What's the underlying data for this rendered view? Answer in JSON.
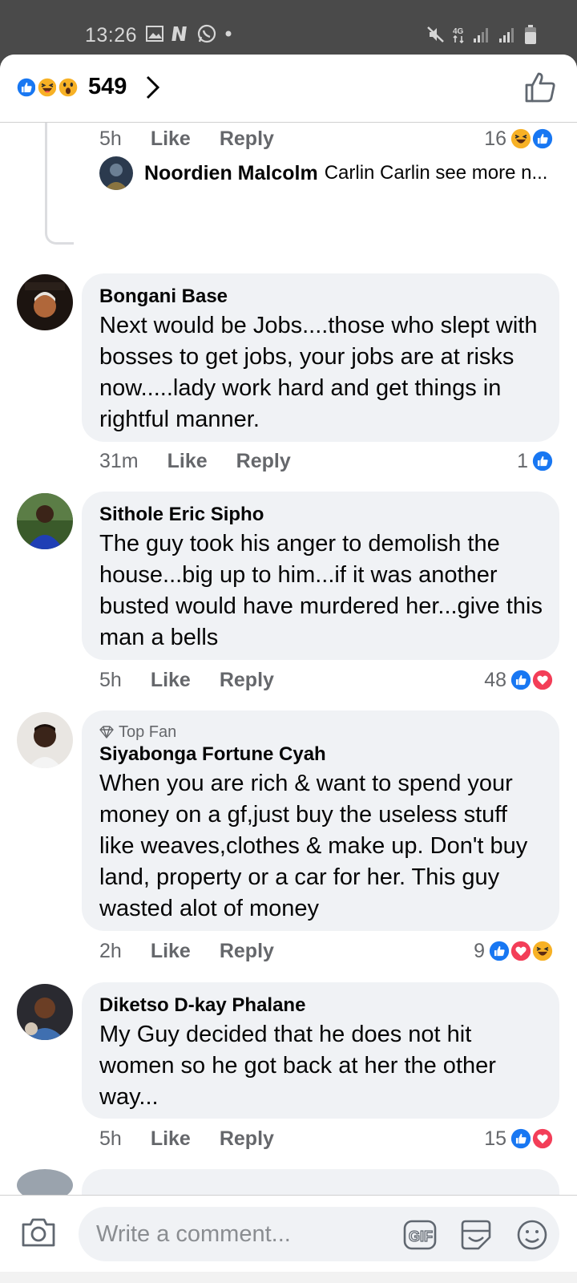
{
  "status_bar": {
    "time": "13:26",
    "left_icons": [
      "gallery-icon",
      "netflix-icon",
      "whatsapp-icon",
      "dot-icon"
    ],
    "right_icons": [
      "mute-icon",
      "4g-icon",
      "signal-icon",
      "signal-icon",
      "battery-icon"
    ]
  },
  "header": {
    "reaction_icons": [
      "like-reaction",
      "haha-reaction",
      "wow-reaction"
    ],
    "reaction_count": "549"
  },
  "top_comment_tail": {
    "time": "5h",
    "like_label": "Like",
    "reply_label": "Reply",
    "reaction_count": "16",
    "reactions": [
      "haha",
      "like"
    ]
  },
  "reply_preview": {
    "author": "Noordien Malcolm",
    "snippet": "Carlin Carlin see more n..."
  },
  "comments": [
    {
      "author": "Bongani Base",
      "badge": "",
      "text": "Next would be Jobs....those who slept with bosses to get jobs, your jobs are at risks now.....lady work hard and get things in rightful manner.",
      "time": "31m",
      "like_label": "Like",
      "reply_label": "Reply",
      "reaction_count": "1",
      "reactions": [
        "like"
      ]
    },
    {
      "author": "Sithole Eric Sipho",
      "badge": "",
      "text": "The guy took his anger to demolish the house...big up to him...if it was another busted would have murdered her...give this man a bells",
      "time": "5h",
      "like_label": "Like",
      "reply_label": "Reply",
      "reaction_count": "48",
      "reactions": [
        "like",
        "love"
      ]
    },
    {
      "author": "Siyabonga Fortune Cyah",
      "badge": "Top Fan",
      "text": "When you are rich & want to spend your money on a gf,just buy the useless stuff like weaves,clothes & make up. Don't buy land, property or a car for her. This guy wasted alot of money",
      "time": "2h",
      "like_label": "Like",
      "reply_label": "Reply",
      "reaction_count": "9",
      "reactions": [
        "like",
        "love",
        "haha"
      ]
    },
    {
      "author": "Diketso D-kay Phalane",
      "badge": "",
      "text": "My Guy decided that he does not hit women so he got back at her the other way...",
      "time": "5h",
      "like_label": "Like",
      "reply_label": "Reply",
      "reaction_count": "15",
      "reactions": [
        "like",
        "love"
      ]
    }
  ],
  "composer": {
    "placeholder": "Write a comment..."
  },
  "colors": {
    "like_blue": "#1877f2",
    "love_red": "#f33e58",
    "haha_yellow": "#f7b125",
    "bubble_gray": "#f0f2f5",
    "meta_gray": "#65676b"
  }
}
